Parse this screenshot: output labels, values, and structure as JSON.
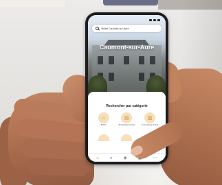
{
  "app": {
    "search_placeholder": "Visiter Caumont-sur-Aure",
    "city_title": "Caumont-sur-Aure",
    "section_title": "Rechercher par catégorie"
  },
  "categories": [
    {
      "label": "Mairie",
      "icon": "building-icon"
    },
    {
      "label": "Entreprises locales",
      "icon": "shop-icon"
    },
    {
      "label": "Commerces locaux",
      "icon": "store-icon"
    }
  ],
  "bottom_nav": [
    {
      "icon": "home-icon",
      "glyph": "⌂",
      "active": true
    },
    {
      "icon": "search-icon",
      "glyph": "⌕",
      "active": false
    },
    {
      "icon": "map-icon",
      "glyph": "◈",
      "active": false
    },
    {
      "icon": "calendar-icon",
      "glyph": "▣",
      "active": false
    },
    {
      "icon": "menu-icon",
      "glyph": "⋯",
      "active": false
    }
  ],
  "colors": {
    "accent": "#d88a1f",
    "category_bg": "#f6dfba",
    "phone_frame": "#1d1d1f"
  }
}
